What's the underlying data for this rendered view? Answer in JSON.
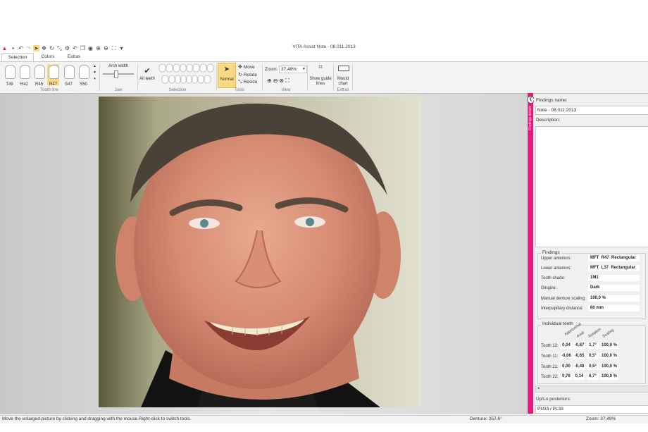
{
  "app": {
    "title": "VITA Assist Note - 08.011.2013"
  },
  "tabs": [
    "Selection",
    "Colors",
    "Extras"
  ],
  "ribbon": {
    "tooth_line": {
      "items": [
        "T49",
        "R42",
        "R45",
        "R47",
        "S47",
        "S50"
      ],
      "selected": "R47",
      "group_label": "Tooth line"
    },
    "jaw": {
      "arch_width_label": "Arch width",
      "group_label": "Jaw"
    },
    "selection": {
      "all_teeth_label": "All teeth",
      "group_label": "Selection"
    },
    "tools": {
      "normal_label": "Normal",
      "move_label": "Move",
      "rotate_label": "Rotate",
      "resize_label": "Resize",
      "group_label": "Tools"
    },
    "view": {
      "zoom_label": "Zoom:",
      "zoom_value": "37,49%",
      "group_label": "View"
    },
    "guides": {
      "label": "Show guide lines"
    },
    "extras": {
      "mould_chart_label": "Mould chart",
      "group_label": "Extras"
    }
  },
  "side_strip": {
    "title": "Findings details"
  },
  "panel": {
    "findings_name_label": "Findings name:",
    "findings_name_value": "Note - 08.011.2013",
    "description_label": "Description:",
    "findings_box_title": "Findings",
    "findings": [
      {
        "label": "Upper anteriors:",
        "values": [
          "MFT",
          "R47",
          "Rectangular"
        ]
      },
      {
        "label": "Lower anteriors:",
        "values": [
          "MFT",
          "L37",
          "Rectangular"
        ]
      },
      {
        "label": "Tooth shade:",
        "values": [
          "1M1"
        ]
      },
      {
        "label": "Gingiva:",
        "values": [
          "Dark"
        ]
      },
      {
        "label": "Manual denture scaling:",
        "values": [
          "100,0 %"
        ]
      },
      {
        "label": "Interpupillary distance:",
        "values": [
          "60   mm"
        ]
      }
    ],
    "individual_box_title": "Individual teeth",
    "individual_columns": [
      "Approximal",
      "Axial",
      "Rotation",
      "Scaling"
    ],
    "individual_rows": [
      {
        "label": "Tooth 12:",
        "values": [
          "0,04",
          "-0,87",
          "1,7°",
          "100,0 %"
        ]
      },
      {
        "label": "Tooth 11:",
        "values": [
          "-0,06",
          "-0,65",
          "0,5°",
          "100,0 %"
        ]
      },
      {
        "label": "Tooth 21:",
        "values": [
          "0,00",
          "-0,48",
          "0,5°",
          "100,0 %"
        ]
      },
      {
        "label": "Tooth 22:",
        "values": [
          "0,78",
          "0,14",
          "6,7°",
          "100,0 %"
        ]
      }
    ],
    "posteriors_label": "Up/Lo posteriors:",
    "posteriors_value": "PU33 / PL33"
  },
  "status": {
    "message": "Move the enlarged picture by clicking and dragging with the mouse.Right-click to switch tools.",
    "denture": "Denture: 357,6°",
    "zoom": "Zoom: 37,49%"
  },
  "colors": {
    "accent": "#e8197a",
    "selected_tool": "#fad983"
  }
}
